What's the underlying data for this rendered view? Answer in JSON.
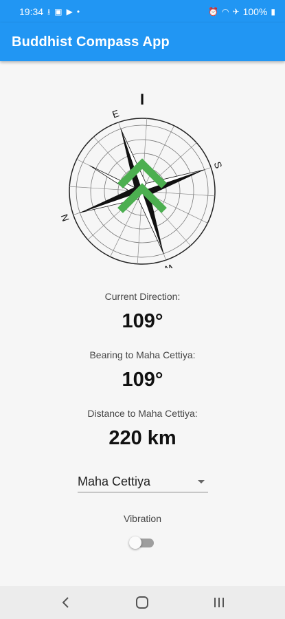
{
  "status_bar": {
    "time": "19:34",
    "battery": "100%",
    "left_icons": [
      "usb-icon",
      "image-icon",
      "notification-app-icon",
      "dot-icon"
    ],
    "right_icons": [
      "alarm-icon",
      "wifi-icon",
      "airplane-icon",
      "battery-icon"
    ]
  },
  "app_bar": {
    "title": "Buddhist Compass App"
  },
  "compass": {
    "cardinals": {
      "north": "N",
      "south": "S",
      "east": "E",
      "west": "W"
    },
    "marker_top": "I",
    "accent_color": "#4caf50"
  },
  "current_direction": {
    "label": "Current Direction:",
    "value": "109°"
  },
  "bearing": {
    "label": "Bearing to Maha Cettiya:",
    "value": "109°"
  },
  "distance": {
    "label": "Distance to Maha Cettiya:",
    "value": "220 km"
  },
  "destination_select": {
    "selected": "Maha Cettiya"
  },
  "vibration": {
    "label": "Vibration",
    "enabled": false
  },
  "nav_bar": {
    "buttons": [
      "back-icon",
      "home-icon",
      "recents-icon"
    ]
  },
  "colors": {
    "primary": "#2196f3",
    "arrow": "#4caf50"
  }
}
